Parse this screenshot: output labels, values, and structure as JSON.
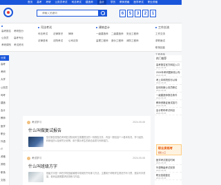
{
  "topnav": [
    "首页",
    "高考",
    "考研",
    "公务员考试",
    "司法考试",
    "建造师",
    "会计",
    "学历",
    "教师资格",
    "医学考试",
    "职业资格"
  ],
  "search": {
    "placeholder": "请输入关键词"
  },
  "counter": [
    "6",
    "5",
    "3",
    "2",
    "1"
  ],
  "catnav": {
    "columns": [
      {
        "title": "",
        "items": [
          "高考报名",
          "考研查分",
          "公务员",
          "高考专业",
          "考研调剂",
          "考试资讯"
        ]
      },
      {
        "title": "司法考试",
        "items": [
          "司法考试",
          "法律常识",
          "律师",
          "法律咨询",
          "法院考试",
          "公司法务"
        ]
      },
      {
        "title": "建筑会计",
        "items": [
          "一级建造师",
          "二级建造师",
          "安全工程师",
          "监理工程师",
          "造价工程师",
          "消防工程师"
        ]
      },
      {
        "title": "工作交流",
        "items": [
          "工作交流",
          "求职面试",
          "职场技能",
          "工作总结"
        ]
      }
    ]
  },
  "sidebar": {
    "head": "分类",
    "items": [
      "高考",
      "考研",
      "大学",
      "公务员",
      "司考",
      "建造",
      "会计",
      "教师",
      "医学",
      "职业",
      "外语",
      "IT",
      "资格",
      "其他",
      "职场",
      "文档"
    ]
  },
  "feed": {
    "posts": [
      {
        "user": "考试学习",
        "date": "2024-05-08",
        "title": "什么叫做复试报告",
        "excerpt": "复试报告是指在考研复试阶段考生需要提交的一份报告文件，内容一般包括个人基本情况、学习经历、科研经历以及研究计划等，用于展示考生的综合素质与科研潜力。"
      },
      {
        "user": "考试学习",
        "date": "2024-05-08",
        "title": "什么叫班级方字",
        "excerpt": "班级方字是一种在学校班级管理中常用的书写练习方法，主要用于帮助学生规范书写习惯，提高写字质量，老师会按照要求安排练习内容。"
      }
    ]
  },
  "aside": {
    "head": "热门推荐",
    "items": [
      {
        "title": "高考报名官方网站入口",
        "meta": "2024-05-08"
      },
      {
        "title": "2024年考研国家线公布",
        "meta": "2024-05-08"
      },
      {
        "title": "考上本科院校可以转",
        "meta": "2024-05-08"
      },
      {
        "title": "如何判断公务员职位",
        "meta": "2024-05-08"
      },
      {
        "title": "一级建造师报名条件",
        "meta": "2024-05-08"
      },
      {
        "title": "教师资格证面试技巧",
        "meta": "2024-05-08"
      },
      {
        "title": "会计职称考试科目",
        "meta": "2024-05-08"
      }
    ],
    "banner_title": "职业资格考",
    "banner_sub": "报名入口",
    "bottom_items": [
      {
        "title": "医学考试报名时间",
        "meta": "2024-05-08"
      },
      {
        "title": "外语等级考试安排",
        "meta": "2024-05-08"
      },
      {
        "title": "职业技能鉴定",
        "meta": "2024-05-08"
      }
    ]
  },
  "colors": {
    "brand": "#1a56db",
    "accent": "#e53935"
  }
}
